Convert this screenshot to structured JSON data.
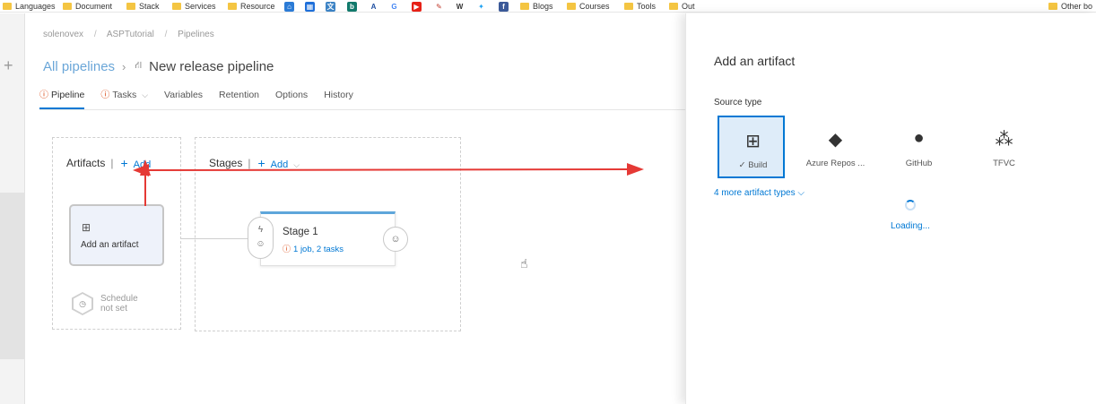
{
  "bookmarks": [
    "Languages",
    "Document",
    "Stack",
    "Services",
    "Resource",
    "Blogs",
    "Courses",
    "Tools",
    "Out",
    "Other bo"
  ],
  "breadcrumb": [
    "solenovex",
    "/",
    "ASPTutorial",
    "/",
    "Pipelines"
  ],
  "header": {
    "all_pipelines": "All pipelines",
    "title": "New release pipeline"
  },
  "tabs": [
    "Pipeline",
    "Tasks",
    "Variables",
    "Retention",
    "Options",
    "History"
  ],
  "artifacts": {
    "heading": "Artifacts",
    "add": "Add",
    "card_label": "Add an artifact"
  },
  "stages": {
    "heading": "Stages",
    "add": "Add",
    "stage_name": "Stage 1",
    "stage_detail": "1 job, 2 tasks"
  },
  "schedule": {
    "line1": "Schedule",
    "line2": "not set"
  },
  "panel": {
    "title": "Add an artifact",
    "source_type_label": "Source type",
    "sources": [
      {
        "label": "Build",
        "icon": "build-icon",
        "selected": true
      },
      {
        "label": "Azure Repos ...",
        "icon": "git-icon",
        "selected": false
      },
      {
        "label": "GitHub",
        "icon": "github-icon",
        "selected": false
      },
      {
        "label": "TFVC",
        "icon": "tfvc-icon",
        "selected": false
      }
    ],
    "more_types": "4 more artifact types",
    "loading": "Loading..."
  },
  "colors": {
    "accent": "#0078d4",
    "annotation_arrow": "#e53935",
    "selected_tile_bg": "#deecf9"
  }
}
